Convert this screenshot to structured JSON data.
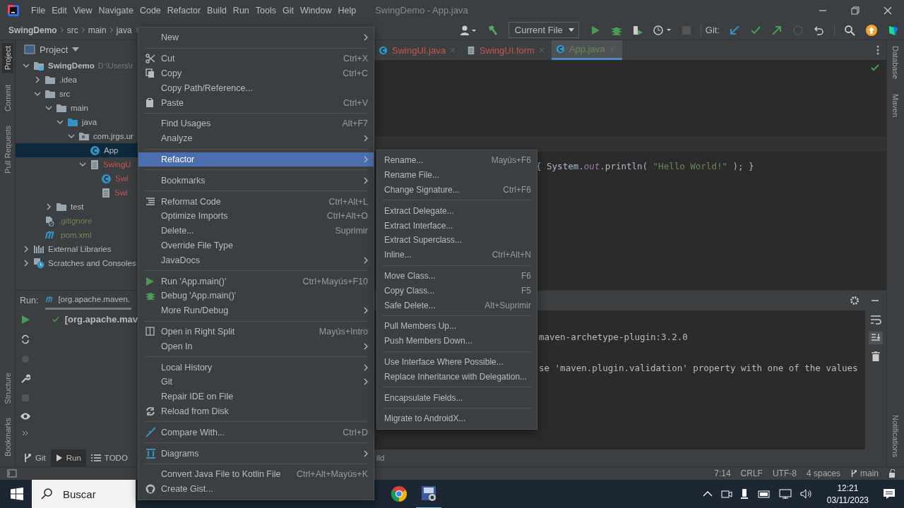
{
  "window": {
    "title": "SwingDemo - App.java"
  },
  "menubar": [
    "File",
    "Edit",
    "View",
    "Navigate",
    "Code",
    "Refactor",
    "Build",
    "Run",
    "Tools",
    "Git",
    "Window",
    "Help"
  ],
  "breadcrumbs": [
    "SwingDemo",
    "src",
    "main",
    "java"
  ],
  "toolbar": {
    "run_config": "Current File",
    "vcs_label": "Git:"
  },
  "left_strip": [
    {
      "label": "Project",
      "selected": true
    },
    {
      "label": "Commit",
      "selected": false
    },
    {
      "label": "Pull Requests",
      "selected": false
    }
  ],
  "left_strip_bottom": [
    {
      "label": "Structure",
      "selected": false
    },
    {
      "label": "Bookmarks",
      "selected": false
    }
  ],
  "right_strip": [
    {
      "label": "Database",
      "selected": false
    },
    {
      "label": "Maven",
      "selected": false
    }
  ],
  "right_strip_bottom": [
    {
      "label": "Notifications",
      "selected": false
    }
  ],
  "project": {
    "title": "Project",
    "tree": [
      {
        "label": "SwingDemo",
        "path": "D:\\Users\\r",
        "kind": "module",
        "expanded": true,
        "selected": false,
        "children": [
          {
            "label": ".idea",
            "kind": "folder",
            "expanded": false,
            "selected": false
          },
          {
            "label": "src",
            "kind": "folder",
            "expanded": true,
            "selected": false,
            "children": [
              {
                "label": "main",
                "kind": "folder",
                "expanded": true,
                "selected": false,
                "children": [
                  {
                    "label": "java",
                    "kind": "source",
                    "expanded": true,
                    "selected": false,
                    "children": [
                      {
                        "label": "com.jrgs.ur",
                        "kind": "package",
                        "expanded": true,
                        "selected": false,
                        "children": [
                          {
                            "label": "App",
                            "kind": "class",
                            "selected": true
                          },
                          {
                            "label": "SwingU",
                            "kind": "form",
                            "color": "#c75450",
                            "expanded": true,
                            "selected": false,
                            "children": [
                              {
                                "label": "Swi",
                                "kind": "class",
                                "color": "#c75450",
                                "selected": false
                              },
                              {
                                "label": "Swi",
                                "kind": "form",
                                "color": "#c75450",
                                "selected": false
                              }
                            ]
                          }
                        ]
                      }
                    ]
                  }
                ]
              },
              {
                "label": "test",
                "kind": "folder",
                "expanded": false,
                "selected": false
              }
            ]
          },
          {
            "label": ".gitignore",
            "kind": "ignore",
            "color": "#6a8759",
            "selected": false
          },
          {
            "label": "pom.xml",
            "kind": "maven",
            "color": "#7f8a52",
            "selected": false
          }
        ]
      },
      {
        "label": "External Libraries",
        "kind": "libraries",
        "expanded": false,
        "selected": false
      },
      {
        "label": "Scratches and Consoles",
        "kind": "scratches",
        "expanded": false,
        "selected": false
      }
    ]
  },
  "editor": {
    "tabs": [
      {
        "label": "SwingUI.java",
        "kind": "class",
        "color": "#c75450",
        "selected": false
      },
      {
        "label": "SwingUI.form",
        "kind": "form",
        "color": "#c75450",
        "selected": false
      },
      {
        "label": "App.java",
        "kind": "class",
        "color": "#6a8759",
        "selected": true
      }
    ],
    "code_line": [
      {
        "text": "{ ",
        "kind": "plain"
      },
      {
        "text": "System.",
        "kind": "plain"
      },
      {
        "text": "out",
        "kind": "field"
      },
      {
        "text": ".println( ",
        "kind": "plain"
      },
      {
        "text": "\"Hello World!\"",
        "kind": "string"
      },
      {
        "text": " ); }",
        "kind": "plain"
      }
    ]
  },
  "run": {
    "label": "Run:",
    "tab": "[org.apache.maven.",
    "tree_item": "[org.apache.mav"
  },
  "console": {
    "lines": [
      "maven-archetype-plugin:3.2.0",
      "se 'maven.plugin.validation' property with one of the values"
    ]
  },
  "tool_tabs": [
    {
      "label": "Git",
      "kind": "git",
      "selected": false
    },
    {
      "label": "Run",
      "kind": "run",
      "selected": true
    },
    {
      "label": "TODO",
      "kind": "todo",
      "selected": false
    }
  ],
  "status_message": "ild",
  "status_bar": {
    "position": "7:14",
    "line_separator": "CRLF",
    "encoding": "UTF-8",
    "indent": "4 spaces",
    "branch": "main"
  },
  "context_menu": {
    "groups": [
      [
        {
          "label": "New",
          "submenu": true,
          "selected": false
        }
      ],
      [
        {
          "label": "Cut",
          "shortcut": "Ctrl+X",
          "submenu": false,
          "selected": false
        },
        {
          "label": "Copy",
          "shortcut": "Ctrl+C",
          "submenu": false,
          "selected": false
        },
        {
          "label": "Copy Path/Reference...",
          "submenu": false,
          "selected": false
        },
        {
          "label": "Paste",
          "shortcut": "Ctrl+V",
          "submenu": false,
          "selected": false
        }
      ],
      [
        {
          "label": "Find Usages",
          "shortcut": "Alt+F7",
          "submenu": false,
          "selected": false
        },
        {
          "label": "Analyze",
          "submenu": true,
          "selected": false
        }
      ],
      [
        {
          "label": "Refactor",
          "submenu": true,
          "selected": true
        }
      ],
      [
        {
          "label": "Bookmarks",
          "submenu": true,
          "selected": false
        }
      ],
      [
        {
          "label": "Reformat Code",
          "shortcut": "Ctrl+Alt+L",
          "submenu": false,
          "selected": false
        },
        {
          "label": "Optimize Imports",
          "shortcut": "Ctrl+Alt+O",
          "submenu": false,
          "selected": false
        },
        {
          "label": "Delete...",
          "shortcut": "Suprimir",
          "submenu": false,
          "selected": false
        },
        {
          "label": "Override File Type",
          "submenu": false,
          "selected": false
        },
        {
          "label": "JavaDocs",
          "submenu": true,
          "selected": false
        }
      ],
      [
        {
          "label": "Run 'App.main()'",
          "shortcut": "Ctrl+Mayús+F10",
          "submenu": false,
          "selected": false
        },
        {
          "label": "Debug 'App.main()'",
          "submenu": false,
          "selected": false
        },
        {
          "label": "More Run/Debug",
          "submenu": true,
          "selected": false
        }
      ],
      [
        {
          "label": "Open in Right Split",
          "shortcut": "Mayús+Intro",
          "submenu": false,
          "selected": false
        },
        {
          "label": "Open In",
          "submenu": true,
          "selected": false
        }
      ],
      [
        {
          "label": "Local History",
          "submenu": true,
          "selected": false
        },
        {
          "label": "Git",
          "submenu": true,
          "selected": false
        },
        {
          "label": "Repair IDE on File",
          "submenu": false,
          "selected": false
        },
        {
          "label": "Reload from Disk",
          "submenu": false,
          "selected": false
        }
      ],
      [
        {
          "label": "Compare With...",
          "shortcut": "Ctrl+D",
          "submenu": false,
          "selected": false
        }
      ],
      [
        {
          "label": "Diagrams",
          "submenu": true,
          "selected": false
        }
      ],
      [
        {
          "label": "Convert Java File to Kotlin File",
          "shortcut": "Ctrl+Alt+Mayús+K",
          "submenu": false,
          "selected": false
        },
        {
          "label": "Create Gist...",
          "submenu": false,
          "selected": false
        }
      ]
    ]
  },
  "refactor_submenu": {
    "groups": [
      [
        {
          "label": "Rename...",
          "shortcut": "Mayús+F6"
        },
        {
          "label": "Rename File..."
        },
        {
          "label": "Change Signature...",
          "shortcut": "Ctrl+F6"
        }
      ],
      [
        {
          "label": "Extract Delegate..."
        },
        {
          "label": "Extract Interface..."
        },
        {
          "label": "Extract Superclass..."
        },
        {
          "label": "Inline...",
          "shortcut": "Ctrl+Alt+N"
        }
      ],
      [
        {
          "label": "Move Class...",
          "shortcut": "F6"
        },
        {
          "label": "Copy Class...",
          "shortcut": "F5"
        },
        {
          "label": "Safe Delete...",
          "shortcut": "Alt+Suprimir"
        }
      ],
      [
        {
          "label": "Pull Members Up..."
        },
        {
          "label": "Push Members Down..."
        }
      ],
      [
        {
          "label": "Use Interface Where Possible..."
        },
        {
          "label": "Replace Inheritance with Delegation..."
        }
      ],
      [
        {
          "label": "Encapsulate Fields..."
        }
      ],
      [
        {
          "label": "Migrate to AndroidX..."
        }
      ]
    ]
  },
  "taskbar": {
    "search_placeholder": "Buscar",
    "time": "12:21",
    "date": "03/11/2023"
  }
}
